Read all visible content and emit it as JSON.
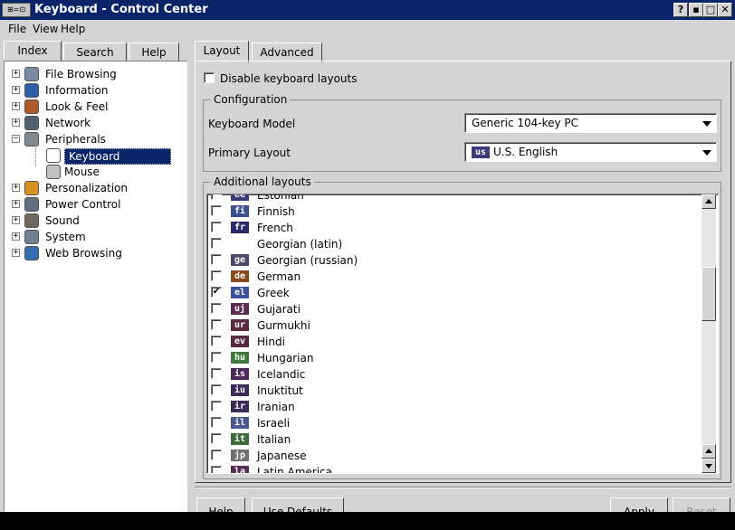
{
  "window": {
    "title": "Keyboard - Control Center",
    "app_icon_text": "⊞=⊡"
  },
  "titlebar_buttons": [
    "?",
    "▪",
    "□",
    "✕"
  ],
  "menubar": [
    {
      "label": "File",
      "key": "F"
    },
    {
      "label": "View",
      "key": "V"
    },
    {
      "label": "Help",
      "key": "H"
    }
  ],
  "left_tabs": [
    {
      "label": "Index",
      "active": true
    },
    {
      "label": "Search",
      "active": false
    },
    {
      "label": "Help",
      "active": false
    }
  ],
  "tree": [
    {
      "label": "File Browsing",
      "icon": "folder-icon",
      "color": "#7a8aa0",
      "expander": "+",
      "level": 0
    },
    {
      "label": "Information",
      "icon": "info-icon",
      "color": "#2a5fa8",
      "expander": "+",
      "level": 0
    },
    {
      "label": "Look & Feel",
      "icon": "paintbrush-icon",
      "color": "#b05a2a",
      "expander": "+",
      "level": 0
    },
    {
      "label": "Network",
      "icon": "network-icon",
      "color": "#506070",
      "expander": "+",
      "level": 0
    },
    {
      "label": "Peripherals",
      "icon": "peripherals-icon",
      "color": "#808890",
      "expander": "−",
      "level": 0
    },
    {
      "label": "Keyboard",
      "icon": "keyboard-icon",
      "color": "#ffffff",
      "expander": "",
      "level": 1,
      "selected": true
    },
    {
      "label": "Mouse",
      "icon": "mouse-icon",
      "color": "#c0c0c0",
      "expander": "",
      "level": 1
    },
    {
      "label": "Personalization",
      "icon": "person-icon",
      "color": "#d89020",
      "expander": "+",
      "level": 0
    },
    {
      "label": "Power Control",
      "icon": "power-icon",
      "color": "#607080",
      "expander": "+",
      "level": 0
    },
    {
      "label": "Sound",
      "icon": "speaker-icon",
      "color": "#706860",
      "expander": "+",
      "level": 0
    },
    {
      "label": "System",
      "icon": "gear-icon",
      "color": "#708090",
      "expander": "+",
      "level": 0
    },
    {
      "label": "Web Browsing",
      "icon": "globe-icon",
      "color": "#3070b0",
      "expander": "+",
      "level": 0
    }
  ],
  "right_tabs": [
    {
      "label": "Layout",
      "active": true
    },
    {
      "label": "Advanced",
      "active": false
    }
  ],
  "disable_layouts": {
    "label": "Disable keyboard layouts",
    "checked": false
  },
  "configuration": {
    "title": "Configuration",
    "model_label": "Keyboard Model",
    "model_value": "Generic 104-key PC",
    "layout_label": "Primary Layout",
    "layout_value": "U.S. English",
    "layout_flag": "us"
  },
  "additional_layouts": {
    "title": "Additional layouts",
    "items": [
      {
        "code": "ee",
        "name": "Estonian",
        "checked": false,
        "flag_color": "#3a3a7a"
      },
      {
        "code": "fi",
        "name": "Finnish",
        "checked": false,
        "flag_color": "#3a5090"
      },
      {
        "code": "fr",
        "name": "French",
        "checked": false,
        "flag_color": "#2a2a6a"
      },
      {
        "code": "",
        "name": "Georgian (latin)",
        "checked": false,
        "flag_color": ""
      },
      {
        "code": "ge",
        "name": "Georgian (russian)",
        "checked": false,
        "flag_color": "#4a4a6a"
      },
      {
        "code": "de",
        "name": "German",
        "checked": false,
        "flag_color": "#8a4a20"
      },
      {
        "code": "el",
        "name": "Greek",
        "checked": true,
        "flag_color": "#3a50a0"
      },
      {
        "code": "uj",
        "name": "Gujarati",
        "checked": false,
        "flag_color": "#5a2a50"
      },
      {
        "code": "ur",
        "name": "Gurmukhi",
        "checked": false,
        "flag_color": "#5a2a40"
      },
      {
        "code": "ev",
        "name": "Hindi",
        "checked": false,
        "flag_color": "#5a2a40"
      },
      {
        "code": "hu",
        "name": "Hungarian",
        "checked": false,
        "flag_color": "#3a7a3a"
      },
      {
        "code": "is",
        "name": "Icelandic",
        "checked": false,
        "flag_color": "#4a2a5a"
      },
      {
        "code": "iu",
        "name": "Inuktitut",
        "checked": false,
        "flag_color": "#3a2a5a"
      },
      {
        "code": "ir",
        "name": "Iranian",
        "checked": false,
        "flag_color": "#3a2a5a"
      },
      {
        "code": "il",
        "name": "Israeli",
        "checked": false,
        "flag_color": "#4a5a90"
      },
      {
        "code": "it",
        "name": "Italian",
        "checked": false,
        "flag_color": "#3a6a3a"
      },
      {
        "code": "jp",
        "name": "Japanese",
        "checked": false,
        "flag_color": "#707070"
      },
      {
        "code": "la",
        "name": "Latin America",
        "checked": false,
        "flag_color": "#5a2a50"
      }
    ]
  },
  "bottom_buttons": [
    {
      "label": "Help",
      "key": "H"
    },
    {
      "label": "Use Defaults",
      "key": "D"
    },
    {
      "label": "Apply",
      "key": "A"
    },
    {
      "label": "Reset",
      "key": "R",
      "disabled": true
    }
  ]
}
